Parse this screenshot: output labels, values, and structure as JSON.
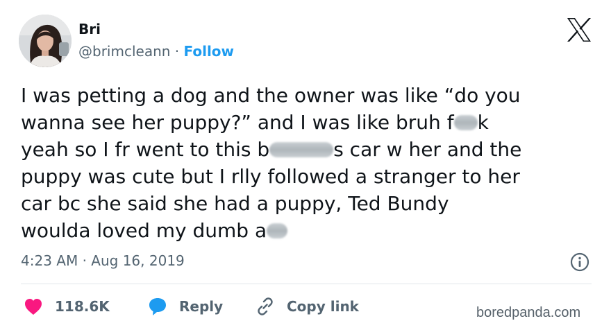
{
  "author": {
    "name": "Bri",
    "handle": "@brimcleann",
    "separator": "·",
    "follow_label": "Follow"
  },
  "tweet": {
    "lines": [
      {
        "parts": [
          "I was petting a dog and the owner was like “do you"
        ]
      },
      {
        "parts": [
          "wanna see her puppy?” and I was like bruh f",
          "k"
        ]
      },
      {
        "parts": [
          "yeah so I fr went to this b",
          "s car w her and the"
        ]
      },
      {
        "parts": [
          "puppy was cute but I rlly followed a stranger to her"
        ]
      },
      {
        "parts": [
          "car bc she said she had a puppy, Ted Bundy"
        ]
      },
      {
        "parts": [
          "woulda loved my dumb a",
          ""
        ]
      }
    ]
  },
  "timestamp": {
    "time": "4:23 AM",
    "separator": "·",
    "date": "Aug 16, 2019"
  },
  "actions": {
    "likes": "118.6K",
    "reply": "Reply",
    "copy_link": "Copy link"
  },
  "watermark": "boredpanda.com",
  "colors": {
    "link": "#1d9bf0",
    "like": "#f91880",
    "reply": "#1d9bf0",
    "muted": "#536471"
  }
}
